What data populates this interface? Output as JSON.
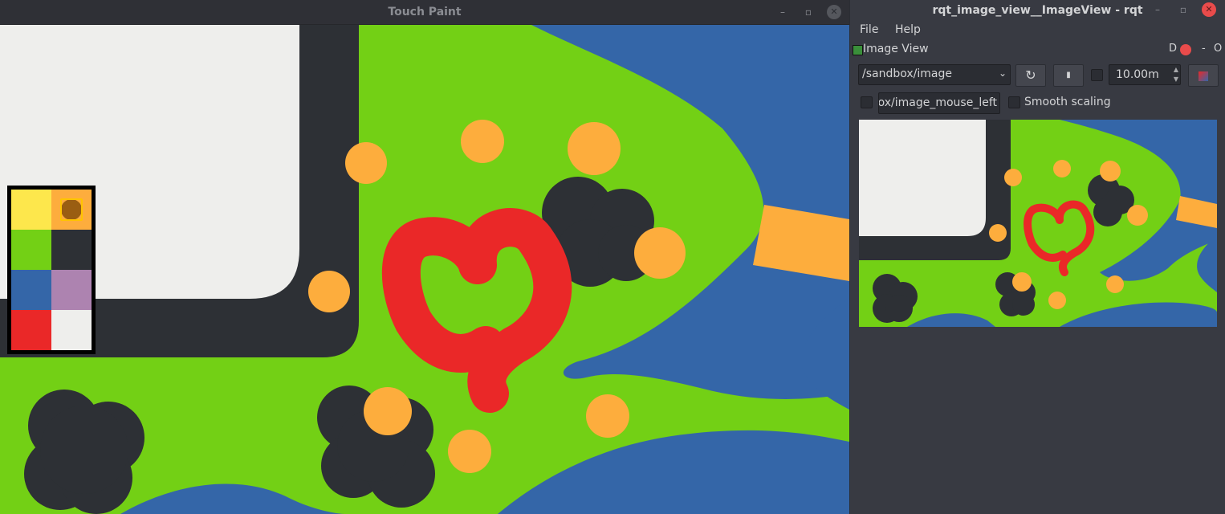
{
  "paint_window": {
    "title": "Touch Paint",
    "minimize_glyph": "–",
    "maximize_glyph": "▫",
    "close_glyph": "✕",
    "palette": {
      "swatches": [
        {
          "name": "yellow",
          "color": "#fde74c"
        },
        {
          "name": "orange",
          "color": "#fdad3d",
          "selected": true
        },
        {
          "name": "green",
          "color": "#73d015"
        },
        {
          "name": "dark",
          "color": "#2d3035"
        },
        {
          "name": "blue",
          "color": "#3466a8"
        },
        {
          "name": "purple",
          "color": "#ad83b0"
        },
        {
          "name": "red",
          "color": "#ea2828"
        },
        {
          "name": "white",
          "color": "#eeeeec"
        }
      ]
    }
  },
  "rqt_window": {
    "title": "rqt_image_view__ImageView - rqt",
    "minimize_glyph": "–",
    "maximize_glyph": "▫",
    "close_glyph": "✕",
    "menus": [
      "File",
      "Help"
    ],
    "dock": {
      "title": "Image View",
      "d_label": "D",
      "float_glyph": "-",
      "close_label": "O"
    },
    "topic": {
      "value": "/sandbox/image",
      "arrow": "⌄"
    },
    "refresh_glyph": "↻",
    "info_glyph": "▮",
    "zoom": {
      "value": "10.00m",
      "up": "▲",
      "down": "▼"
    },
    "mouse_topic": {
      "value": "ox/image_mouse_left"
    },
    "smooth_scaling_label": "Smooth scaling"
  },
  "colors": {
    "green": "#73d015",
    "dark": "#2d3035",
    "blue": "#3466a8",
    "orange": "#fdad3d",
    "red": "#ea2828",
    "white": "#eeeeec"
  }
}
